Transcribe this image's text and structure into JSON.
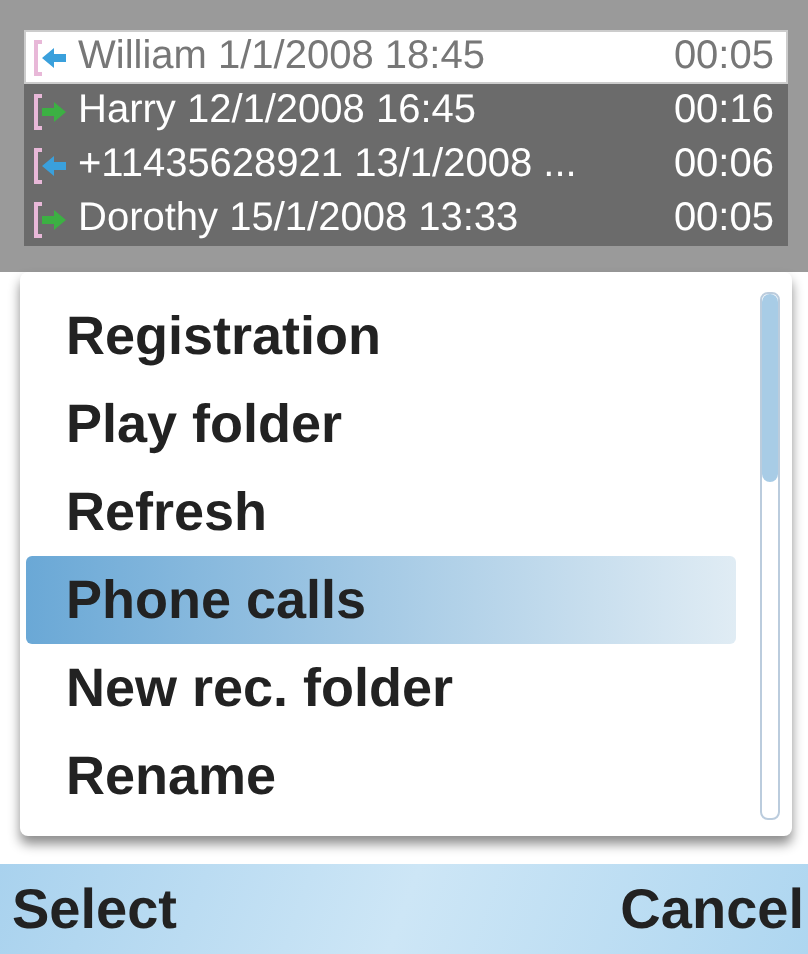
{
  "call_log": [
    {
      "kind": "incoming",
      "text": "William 1/1/2008 18:45",
      "duration": "00:05",
      "selected": true
    },
    {
      "kind": "outgoing",
      "text": "Harry 12/1/2008 16:45",
      "duration": "00:16",
      "selected": false
    },
    {
      "kind": "incoming",
      "text": "+11435628921 13/1/2008 ...",
      "duration": "00:06",
      "selected": false
    },
    {
      "kind": "outgoing",
      "text": "Dorothy 15/1/2008 13:33",
      "duration": "00:05",
      "selected": false
    }
  ],
  "menu": {
    "items": [
      {
        "label": "Registration",
        "selected": false
      },
      {
        "label": "Play folder",
        "selected": false
      },
      {
        "label": "Refresh",
        "selected": false
      },
      {
        "label": "Phone calls",
        "selected": true
      },
      {
        "label": "New rec. folder",
        "selected": false
      },
      {
        "label": "Rename",
        "selected": false
      }
    ]
  },
  "softkeys": {
    "left": "Select",
    "right": "Cancel"
  }
}
